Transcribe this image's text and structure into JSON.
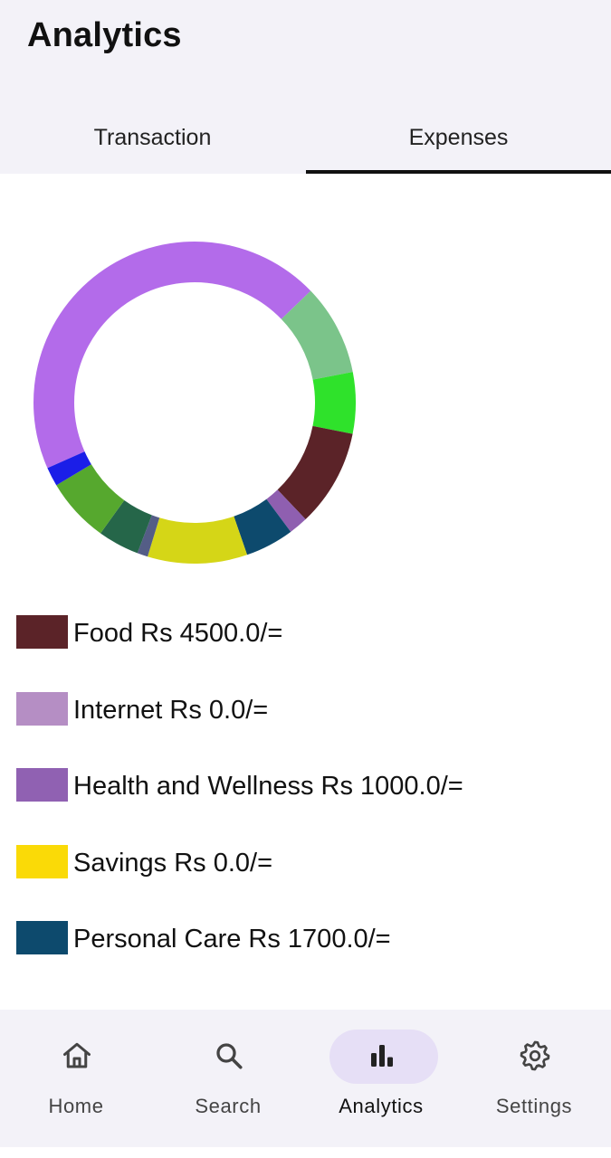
{
  "header": {
    "title": "Analytics"
  },
  "tabs": [
    {
      "label": "Transaction",
      "active": false
    },
    {
      "label": "Expenses",
      "active": true
    }
  ],
  "chart_data": {
    "type": "pie",
    "style": "donut",
    "slices": [
      {
        "name": "",
        "color": "#b36bea",
        "fraction": 0.418
      },
      {
        "name": "",
        "color": "#7bc48a",
        "fraction": 0.086
      },
      {
        "name": "",
        "color": "#2fe22b",
        "fraction": 0.058
      },
      {
        "name": "",
        "color": "#5b2328",
        "fraction": 0.092
      },
      {
        "name": "",
        "color": "#8f5fb0",
        "fraction": 0.018
      },
      {
        "name": "",
        "color": "#0d4a6d",
        "fraction": 0.046
      },
      {
        "name": "",
        "color": "#d5d617",
        "fraction": 0.094
      },
      {
        "name": "",
        "color": "#545d86",
        "fraction": 0.01
      },
      {
        "name": "",
        "color": "#256649",
        "fraction": 0.039
      },
      {
        "name": "",
        "color": "#56a82e",
        "fraction": 0.061
      },
      {
        "name": "",
        "color": "#1b1ee8",
        "fraction": 0.018
      }
    ]
  },
  "legend": [
    {
      "label": "Food Rs 4500.0/=",
      "color": "#5b2328"
    },
    {
      "label": "Internet Rs 0.0/=",
      "color": "#b58ec4"
    },
    {
      "label": "Health and Wellness Rs 1000.0/=",
      "color": "#9061b2"
    },
    {
      "label": "Savings Rs 0.0/=",
      "color": "#fada07"
    },
    {
      "label": "Personal Care Rs 1700.0/=",
      "color": "#0d4a6d"
    }
  ],
  "nav": [
    {
      "label": "Home",
      "icon": "home-icon",
      "active": false
    },
    {
      "label": "Search",
      "icon": "search-icon",
      "active": false
    },
    {
      "label": "Analytics",
      "icon": "bar-chart-icon",
      "active": true
    },
    {
      "label": "Settings",
      "icon": "gear-icon",
      "active": false
    }
  ]
}
